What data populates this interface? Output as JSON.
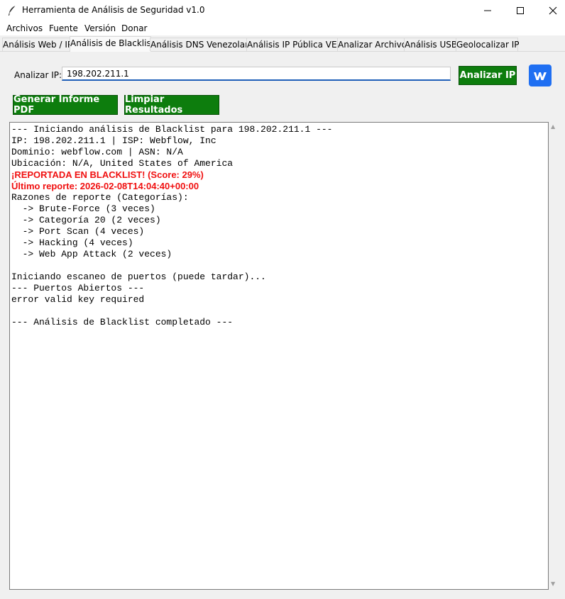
{
  "window": {
    "title": "Herramienta de Análisis de Seguridad v1.0",
    "app_icon": "feather-icon",
    "controls": [
      "minimize-icon",
      "maximize-icon",
      "close-icon"
    ]
  },
  "menu": [
    "Archivos",
    "Fuente",
    "Versión",
    "Donar"
  ],
  "tabs": [
    {
      "label": "Análisis Web / IP",
      "active": false
    },
    {
      "label": "Análisis de Blacklist",
      "active": true
    },
    {
      "label": "Análisis DNS Venezolano",
      "active": false
    },
    {
      "label": "Análisis IP Pública VEN",
      "active": false
    },
    {
      "label": "Analizar Archivo",
      "active": false
    },
    {
      "label": "Análisis USB",
      "active": false
    },
    {
      "label": "Geolocalizar IP",
      "active": false
    }
  ],
  "form": {
    "ip_label": "Analizar IP:",
    "ip_value": "198.202.211.1",
    "analyze_button": "Analizar IP",
    "pdf_button": "Generar Informe PDF",
    "clear_button": "Limpiar Resultados",
    "brand_icon": "webflow-icon"
  },
  "colors": {
    "button_green": "#0d7d0d",
    "alert_red": "#f01010",
    "brand_blue": "#1f6ff2"
  },
  "output": {
    "lines": [
      {
        "text": "--- Iniciando análisis de Blacklist para 198.202.211.1 ---",
        "style": "normal"
      },
      {
        "text": "IP: 198.202.211.1 | ISP: Webflow, Inc",
        "style": "normal"
      },
      {
        "text": "Dominio: webflow.com | ASN: N/A",
        "style": "normal"
      },
      {
        "text": "Ubicación: N/A, United States of America",
        "style": "normal"
      },
      {
        "text": "¡REPORTADA EN BLACKLIST! (Score: 29%)",
        "style": "alert"
      },
      {
        "text": "Último reporte: 2026-02-08T14:04:40+00:00",
        "style": "alert"
      },
      {
        "text": "Razones de reporte (Categorías):",
        "style": "normal"
      },
      {
        "text": "  -> Brute-Force (3 veces)",
        "style": "normal"
      },
      {
        "text": "  -> Categoría 20 (2 veces)",
        "style": "normal"
      },
      {
        "text": "  -> Port Scan (4 veces)",
        "style": "normal"
      },
      {
        "text": "  -> Hacking (4 veces)",
        "style": "normal"
      },
      {
        "text": "  -> Web App Attack (2 veces)",
        "style": "normal"
      },
      {
        "text": "",
        "style": "normal"
      },
      {
        "text": "Iniciando escaneo de puertos (puede tardar)...",
        "style": "normal"
      },
      {
        "text": "--- Puertos Abiertos ---",
        "style": "normal"
      },
      {
        "text": "error valid key required",
        "style": "normal"
      },
      {
        "text": "",
        "style": "normal"
      },
      {
        "text": "--- Análisis de Blacklist completado ---",
        "style": "normal"
      }
    ]
  }
}
